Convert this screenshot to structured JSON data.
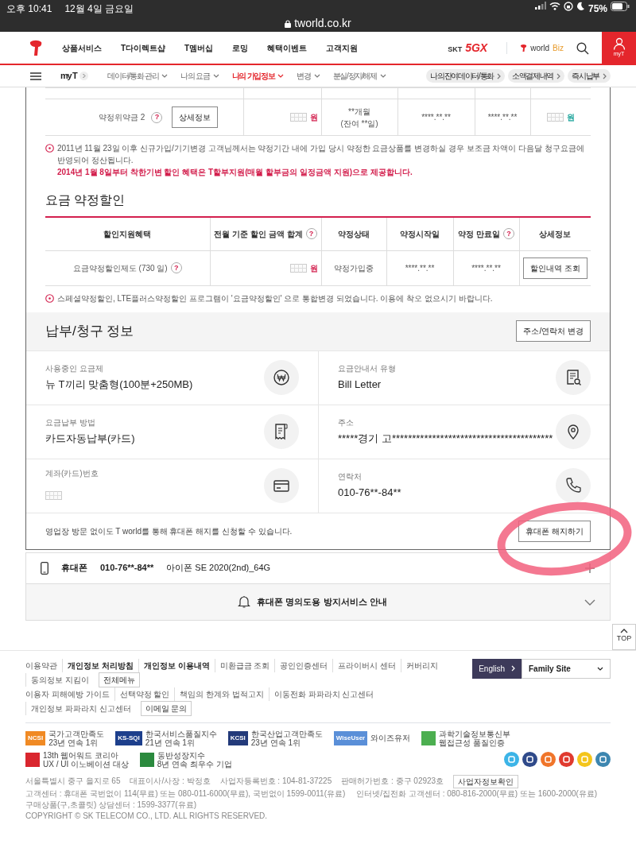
{
  "status_bar": {
    "time": "오후 10:41",
    "date": "12월 4일 금요일",
    "url": "tworld.co.kr",
    "battery": "75%"
  },
  "header": {
    "nav": [
      "상품서비스",
      "T다이렉트샵",
      "T멤버십",
      "로밍",
      "혜택이벤트",
      "고객지원"
    ],
    "brand_prefix": "SKT",
    "brand_mark": "5GX",
    "biz_name": "world",
    "biz_suffix": "Biz",
    "my_label": "myT"
  },
  "subnav": {
    "home": "my T",
    "items": [
      {
        "label": "데이터/통화 관리",
        "selected": false
      },
      {
        "label": "나의 요금",
        "selected": false
      },
      {
        "label": "나의 가입정보",
        "selected": true
      },
      {
        "label": "변경",
        "selected": false
      },
      {
        "label": "분실/정지/해제",
        "selected": false
      }
    ],
    "quick": [
      "나의잔여데이터/통화",
      "소액결제내역",
      "즉시납부"
    ]
  },
  "penalty_row": {
    "label": "약정위약금 2",
    "help": "?",
    "button": "상세정보",
    "amount_unit": "원",
    "period": "**개월",
    "remaining": "(잔여 **일)",
    "start": "****.**.**",
    "end": "****.**.**",
    "refund_unit": "원"
  },
  "notice": {
    "text": "2011년 11월 23일 이후 신규가입/기기변경 고객님께서는 약정기간 내에 가입 당시 약정한 요금상품를 변경하실 경우 보조금 차액이 다음달 청구요금에 반영되어 정산됩니다.",
    "highlight": "2014년 1월 8일부터 착한기변 할인 혜택은 T할부지원(매월 할부금의 일정금액 지원)으로 제공합니다."
  },
  "discount": {
    "title": "요금 약정할인",
    "columns": [
      {
        "label": "할인지원혜택"
      },
      {
        "label": "전월 기준 할인 금액 합계",
        "help": "?"
      },
      {
        "label": "약정상태"
      },
      {
        "label": "약정시작일"
      },
      {
        "label": "약정 만료일",
        "help": "?"
      },
      {
        "label": "상세정보"
      }
    ],
    "row": {
      "name": "요금약정할인제도 (730 일)",
      "help": "?",
      "unit": "원",
      "status": "약정가입중",
      "start": "****.**.**",
      "end": "****.**.**",
      "button": "할인내역 조회"
    },
    "note": "스페셜약정할인, LTE플러스약정할인 프로그램이 '요금약정할인' 으로 통합변경 되었습니다. 이용에 착오 없으시기 바랍니다."
  },
  "billing": {
    "title": "납부/청구 정보",
    "button": "주소/연락처 변경",
    "fields": [
      {
        "label": "사용중인 요금제",
        "value": "뉴 T끼리 맞춤형(100분+250MB)"
      },
      {
        "label": "요금안내서 유형",
        "value": "Bill Letter"
      },
      {
        "label": "요금납부 방법",
        "value": "카드자동납부(카드)"
      },
      {
        "label": "주소",
        "value": "*****경기 고****************************************"
      },
      {
        "label": "계좌(카드)번호",
        "masked": true
      },
      {
        "label": "연락처",
        "value": "010-76**-84**"
      }
    ],
    "footer_text": "영업장 방문 없이도 T world를 통해 휴대폰 해지를 신청할 수 있습니다.",
    "footer_button": "휴대폰 해지하기"
  },
  "line": {
    "label": "휴대폰",
    "number": "010-76**-84**",
    "model": "아이폰 SE 2020(2nd)_64G",
    "expanded": false
  },
  "guide": {
    "label": "휴대폰 명의도용 방지서비스 안내",
    "expanded": false
  },
  "top_button": "TOP",
  "footer": {
    "link_rows": [
      {
        "links": [
          {
            "label": "이용약관",
            "bold": false
          },
          {
            "label": "개인정보 처리방침",
            "bold": true
          },
          {
            "label": "개인정보 이용내역",
            "bold": true
          },
          {
            "label": "미환급금 조회",
            "bold": false
          },
          {
            "label": "공인인증센터",
            "bold": false
          },
          {
            "label": "프라이버시 센터",
            "bold": false
          },
          {
            "label": "커버리지",
            "bold": false
          },
          {
            "label": "동의정보 지킴이",
            "bold": false
          }
        ],
        "button": "전체메뉴"
      },
      {
        "links": [
          {
            "label": "이용자 피해예방 가이드",
            "bold": false
          },
          {
            "label": "선택약정 할인",
            "bold": false
          },
          {
            "label": "책임의 한계와 법적고지",
            "bold": false
          },
          {
            "label": "이동전화 파파라치 신고센터",
            "bold": false
          },
          {
            "label": "개인정보 파파라치 신고센터",
            "bold": false
          }
        ],
        "button": "이메일 문의"
      }
    ],
    "language": "English",
    "family_site": "Family Site",
    "awards": [
      {
        "logo": "NCSI",
        "color": "#f08a24",
        "name": "국가고객만족도",
        "sub": "23년 연속 1위"
      },
      {
        "logo": "KS-SQI",
        "color": "#1d3f8c",
        "name": "한국서비스품질지수",
        "sub": "21년 연속 1위"
      },
      {
        "logo": "KCSI",
        "color": "#233a7a",
        "name": "한국산업고객만족도",
        "sub": "23년 연속 1위"
      },
      {
        "logo": "WiseUser",
        "color": "#5a8fd8",
        "name": "와이즈유저"
      },
      {
        "color": "#4caf50",
        "name": "과학기술정보통신부",
        "sub": "웹접근성 품질인증"
      },
      {
        "color": "#d9262e",
        "name": "13th 웹어워드 코리아",
        "sub": "UX / UI 이노베이션 대상"
      },
      {
        "color": "#2b8a3e",
        "name": "동반성장지수",
        "sub": "8년 연속 최우수 기업"
      }
    ],
    "social": [
      {
        "color": "#3cb4e7"
      },
      {
        "color": "#2f4a8a"
      },
      {
        "color": "#f0752a"
      },
      {
        "color": "#e03a2f"
      },
      {
        "color": "#f4c51b"
      },
      {
        "color": "#3d86b0"
      }
    ],
    "company": [
      "서울특별시 중구 을지로 65",
      "대표이사/사장 : 박정호",
      "사업자등록번호 : 104-81-37225",
      "판매허가번호 : 중구 02923호"
    ],
    "company_button": "사업자정보확인",
    "centers": [
      "고객센터 : 휴대폰 국번없이 114(무료) 또는 080-011-6000(무료), 국번없이 1599-0011(유료)",
      "인터넷/집전화 고객센터 : 080-816-2000(무료) 또는 1600-2000(유료)",
      "구매상품(구,초콜릿) 상담센터 : 1599-3377(유료)"
    ],
    "copyright": "COPYRIGHT © SK TELECOM CO., LTD. ALL RIGHTS RESERVED."
  }
}
